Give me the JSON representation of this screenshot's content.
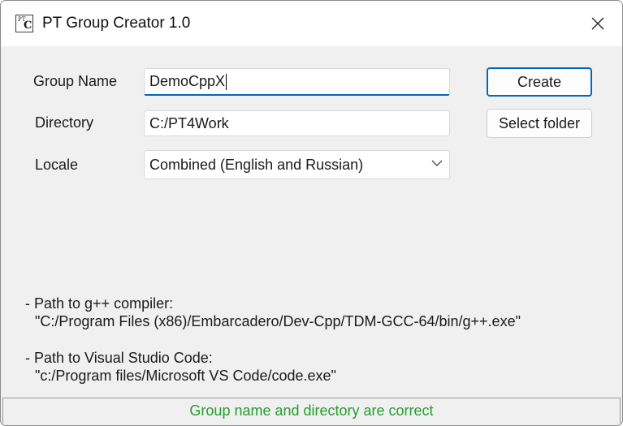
{
  "window": {
    "title": "PT Group Creator 1.0",
    "icon": "pt-c-app-icon"
  },
  "form": {
    "group_name_label": "Group Name",
    "group_name_value": "DemoCppX",
    "directory_label": "Directory",
    "directory_value": "C:/PT4Work",
    "locale_label": "Locale",
    "locale_value": "Combined (English and Russian)"
  },
  "buttons": {
    "create": "Create",
    "select_folder": "Select folder"
  },
  "info": {
    "compiler_heading": "- Path to g++ compiler:",
    "compiler_path": "\"C:/Program Files (x86)/Embarcadero/Dev-Cpp/TDM-GCC-64/bin/g++.exe\"",
    "vscode_heading": "- Path to Visual Studio Code:",
    "vscode_path": "\"c:/Program files/Microsoft VS Code/code.exe\""
  },
  "status": {
    "text": "Group name and directory are correct",
    "color": "#22a02a"
  },
  "colors": {
    "accent": "#0067c0"
  }
}
